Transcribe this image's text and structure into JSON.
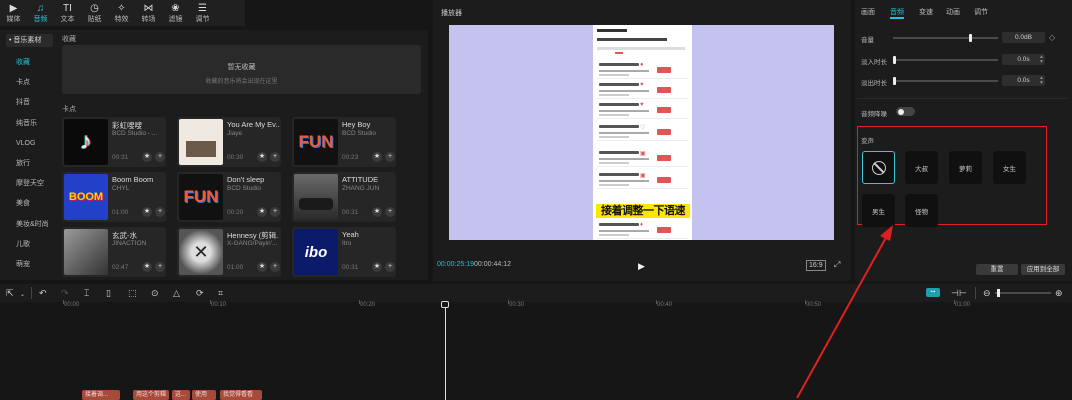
{
  "toolbar": {
    "tabs": [
      {
        "icon": "▶",
        "label": "媒体"
      },
      {
        "icon": "♫",
        "label": "音频"
      },
      {
        "icon": "TI",
        "label": "文本"
      },
      {
        "icon": "◷",
        "label": "贴纸"
      },
      {
        "icon": "✧",
        "label": "特效"
      },
      {
        "icon": "⋈",
        "label": "转场"
      },
      {
        "icon": "❀",
        "label": "滤镜"
      },
      {
        "icon": "☰",
        "label": "调节"
      }
    ]
  },
  "sidebar": {
    "header": "• 音乐素材",
    "items": [
      "收藏",
      "卡点",
      "抖音",
      "纯音乐",
      "VLOG",
      "旅行",
      "摩登天空",
      "美食",
      "美妆&时尚",
      "儿歌",
      "萌宠"
    ]
  },
  "library": {
    "fav_label": "收藏",
    "fav_empty_title": "暂无收藏",
    "fav_empty_hint": "收藏的音乐将会出现在这里",
    "beat_label": "卡点",
    "cards": [
      {
        "title": "彩虹嗖嗖",
        "artist": "BCD Studio - ...",
        "duration": "00:31",
        "thumb": "♪"
      },
      {
        "title": "You Are My Ev...",
        "artist": "Jiaye",
        "duration": "00:30",
        "thumb": ""
      },
      {
        "title": "Hey Boy",
        "artist": "BCD Studio",
        "duration": "00:23",
        "thumb": "FUN"
      },
      {
        "title": "Boom Boom",
        "artist": "CHYL",
        "duration": "01:00",
        "thumb": "BOOM"
      },
      {
        "title": "Don't sleep",
        "artist": "BCD Studio",
        "duration": "00:20",
        "thumb": "FUN"
      },
      {
        "title": "ATTITUDE",
        "artist": "ZHANG JUN",
        "duration": "00:31",
        "thumb": ""
      },
      {
        "title": "玄武-水",
        "artist": "JINACTION",
        "duration": "02:47",
        "thumb": ""
      },
      {
        "title": "Hennesy (剪辑...",
        "artist": "X-GANG/Payin'...",
        "duration": "01:00",
        "thumb": "✕"
      },
      {
        "title": "Yeah",
        "artist": "Itro",
        "duration": "00:31",
        "thumb": "ibo"
      }
    ]
  },
  "player": {
    "title": "播放器",
    "current_time": "00:00:25:19",
    "total_time": "00:00:44:12",
    "ratio": "16:9",
    "subtitle": "接着调整一下语速"
  },
  "right_panel": {
    "tabs": [
      "画面",
      "音频",
      "变速",
      "动画",
      "调节"
    ],
    "active_tab": "音频",
    "volume_label": "音量",
    "volume_value": "0.0dB",
    "volume_level": 0.72,
    "fadein_label": "淡入时长",
    "fadein_value": "0.0s",
    "fadeout_label": "淡出时长",
    "fadeout_value": "0.0s",
    "denoise_label": "音频降噪",
    "voice_change_label": "变声",
    "voice_options": [
      "",
      "大叔",
      "萝莉",
      "女生",
      "男生",
      "怪物"
    ],
    "reset_label": "重置",
    "apply_all_label": "应用到全部"
  },
  "timeline": {
    "ticks": [
      "00:00",
      "00:10",
      "00:20",
      "00:30",
      "00:40",
      "00:50",
      "01:00"
    ],
    "clips": [
      "接着调...",
      "用这个剪辑",
      "这...",
      "使用",
      "我觉得看看"
    ]
  },
  "colors": {
    "accent": "#1fc5d6",
    "highlight_box": "#e02020",
    "clip": "#a84a3a"
  }
}
